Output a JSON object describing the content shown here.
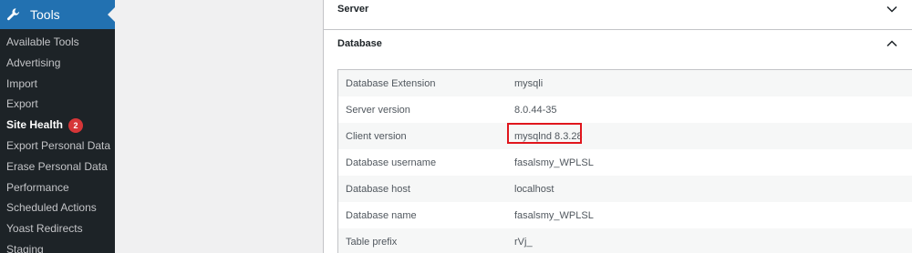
{
  "sidebar": {
    "header_label": "Tools",
    "items": [
      {
        "label": "Available Tools"
      },
      {
        "label": "Advertising"
      },
      {
        "label": "Import"
      },
      {
        "label": "Export"
      },
      {
        "label": "Site Health",
        "badge": "2"
      },
      {
        "label": "Export Personal Data"
      },
      {
        "label": "Erase Personal Data"
      },
      {
        "label": "Performance"
      },
      {
        "label": "Scheduled Actions"
      },
      {
        "label": "Yoast Redirects"
      },
      {
        "label": "Staging"
      }
    ]
  },
  "sections": {
    "server": {
      "title": "Server"
    },
    "database": {
      "title": "Database"
    }
  },
  "database_rows": [
    {
      "label": "Database Extension",
      "value": "mysqli"
    },
    {
      "label": "Server version",
      "value": "8.0.44-35"
    },
    {
      "label": "Client version",
      "value": "mysqlnd 8.3.28"
    },
    {
      "label": "Database username",
      "value": "fasalsmy_WPLSL"
    },
    {
      "label": "Database host",
      "value": "localhost"
    },
    {
      "label": "Database name",
      "value": "fasalsmy_WPLSL"
    },
    {
      "label": "Table prefix",
      "value": "rVj_"
    }
  ],
  "colors": {
    "sidebar_bg": "#1d2327",
    "accent": "#2271b1",
    "highlight_border": "#e0161d",
    "badge": "#d63638"
  }
}
